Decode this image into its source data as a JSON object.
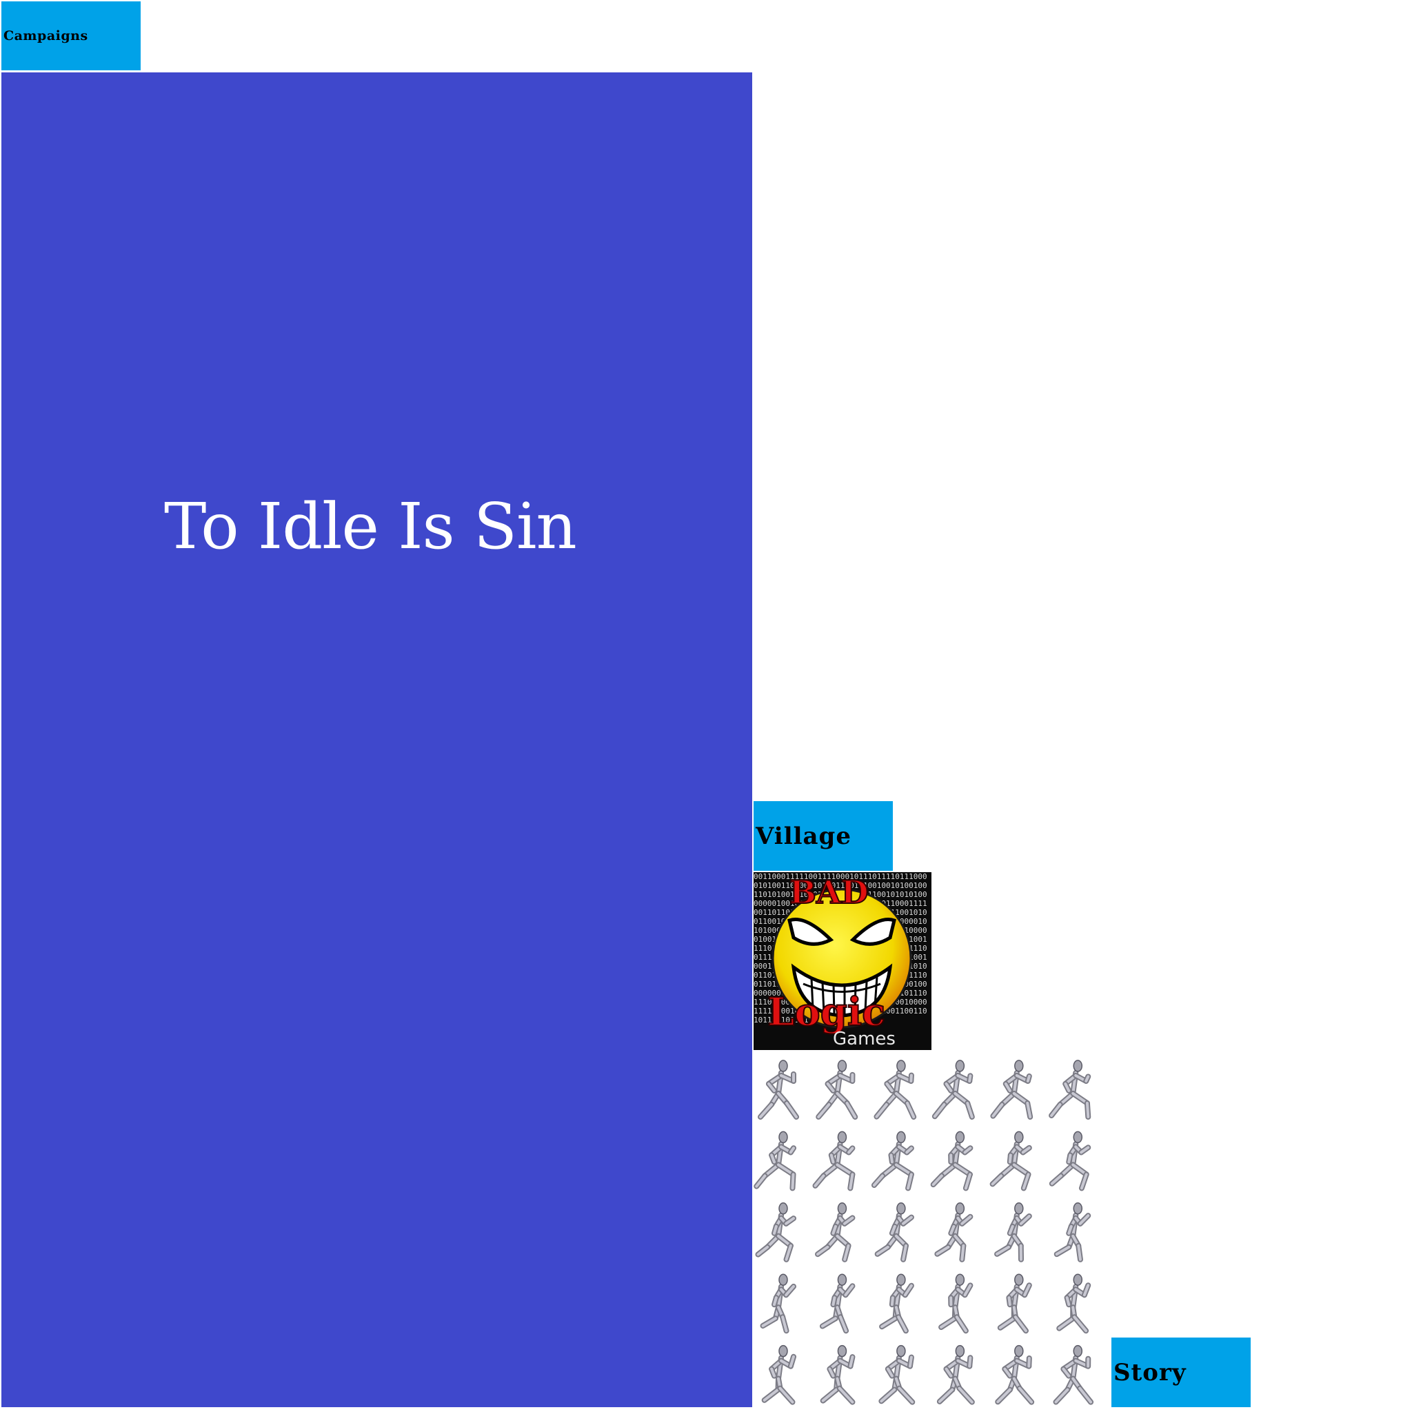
{
  "tabs": {
    "campaigns": "Campaigns",
    "village": "Village",
    "story": "Story"
  },
  "title_panel": {
    "title": "To Idle Is Sin",
    "background": "#3f48cc"
  },
  "logo": {
    "word_top": "BAD",
    "word_bottom": "Logic",
    "word_small": "Games",
    "icon": "grinning-smiley-icon"
  },
  "sprite_sheet": {
    "icon": "running-man-sprite",
    "rows": 5,
    "cols": 6
  },
  "colors": {
    "tab_background": "#00a2e8",
    "page_background": "#ffffff",
    "title_text": "#ffffff"
  }
}
